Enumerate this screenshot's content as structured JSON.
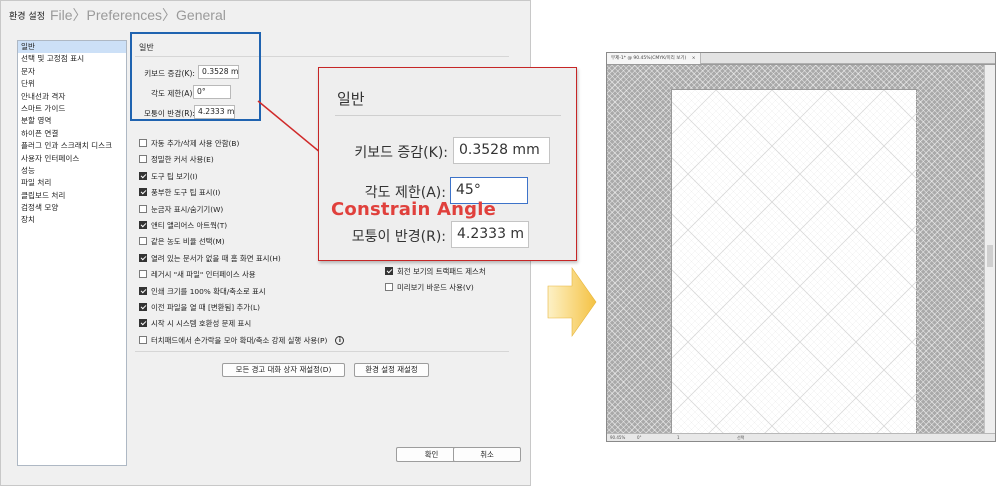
{
  "dialog": {
    "title": "환경 설정",
    "path_label": "File〉Preferences〉General",
    "categories": [
      {
        "label": "일반",
        "selected": true
      },
      {
        "label": "선택 및 고정점 표시",
        "selected": false
      },
      {
        "label": "문자",
        "selected": false
      },
      {
        "label": "단위",
        "selected": false
      },
      {
        "label": "안내선과 격자",
        "selected": false
      },
      {
        "label": "스마트 가이드",
        "selected": false
      },
      {
        "label": "분할 영역",
        "selected": false
      },
      {
        "label": "하이픈 연결",
        "selected": false
      },
      {
        "label": "플러그 인과 스크래치 디스크",
        "selected": false
      },
      {
        "label": "사용자 인터페이스",
        "selected": false
      },
      {
        "label": "성능",
        "selected": false
      },
      {
        "label": "파일 처리",
        "selected": false
      },
      {
        "label": "클립보드 처리",
        "selected": false
      },
      {
        "label": "검정색 모양",
        "selected": false
      },
      {
        "label": "장치",
        "selected": false
      }
    ],
    "group_title": "일반",
    "fields": {
      "keyboard_increment": {
        "label": "키보드 증감(K):",
        "value": "0.3528 mm"
      },
      "constrain_angle": {
        "label": "각도 제한(A):",
        "value": "0°"
      },
      "corner_radius": {
        "label": "모퉁이 반경(R):",
        "value": "4.2333 m"
      }
    },
    "checkboxes_left": [
      {
        "label": "자동 추가/삭제 사용 안함(B)",
        "checked": false
      },
      {
        "label": "정밀한 커서 사용(E)",
        "checked": false
      },
      {
        "label": "도구 팁 보기(I)",
        "checked": true
      },
      {
        "label": "풍부한 도구 팁 표시(I)",
        "checked": true
      },
      {
        "label": "눈금자 표시/숨기기(W)",
        "checked": false
      },
      {
        "label": "앤티 앨리어스 아트웍(T)",
        "checked": true
      },
      {
        "label": "같은 농도 비율 선택(M)",
        "checked": false
      },
      {
        "label": "열려 있는 문서가 없을 때 홈 화면 표시(H)",
        "checked": true
      },
      {
        "label": "레거시 \"새 파일\" 인터페이스 사용",
        "checked": false
      },
      {
        "label": "인쇄 크기를 100% 확대/축소로 표시",
        "checked": true
      },
      {
        "label": "이전 파일을 열 때 [변환됨] 추가(L)",
        "checked": true
      },
      {
        "label": "시작 시 시스템 호환성 문제 표시",
        "checked": true
      },
      {
        "label": "터치패드에서 손가락을 모아 확대/축소 강제 실행 사용(P)",
        "checked": false
      }
    ],
    "checkboxes_right": [
      {
        "label": "회전 보기의 트랙패드 제스처",
        "checked": true
      },
      {
        "label": "미리보기 바운드 사용(V)",
        "checked": false
      }
    ],
    "reset_warnings_button": "모든 경고 대화 상자 재설정(D)",
    "reset_prefs_button": "환경 설정 재설정",
    "ok_button": "확인",
    "cancel_button": "취소"
  },
  "callout": {
    "group_title": "일반",
    "keyboard_increment": {
      "label": "키보드 증감(K):",
      "value": "0.3528 mm"
    },
    "constrain_angle": {
      "label": "각도 제한(A):",
      "value": "45°"
    },
    "corner_radius": {
      "label": "모퉁이 반경(R):",
      "value": "4.2333 m"
    },
    "note": "Constrain Angle"
  },
  "canvas_window": {
    "tab_label": "무제-1* @ 90.45%(CMYK/미리 보기)",
    "status_zoom": "90.45%",
    "status_angle": "0°",
    "status_page": "1",
    "status_tool": "선택"
  },
  "colors": {
    "highlight_blue": "#1f63b0",
    "callout_red": "#c62626",
    "note_red": "#e0403c",
    "arrow_yellow": "#f5c842"
  }
}
